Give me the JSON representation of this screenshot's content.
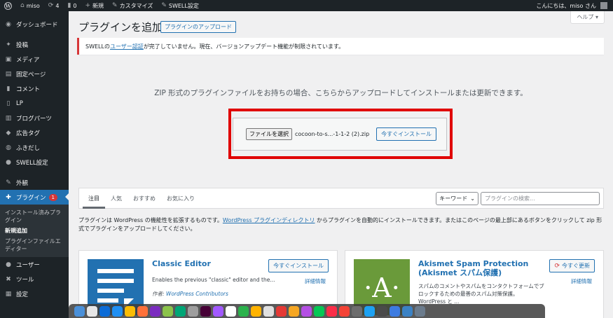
{
  "adminbar": {
    "site_name": "miso",
    "updates_count": "4",
    "comments_count": "0",
    "new_label": "新規",
    "customize_label": "カスタマイズ",
    "swell_label": "SWELL設定",
    "greeting": "こんにちは、miso さん"
  },
  "sidebar": {
    "items": [
      {
        "label": "ダッシュボード",
        "icon": "dashboard-icon"
      },
      {
        "label": "投稿",
        "icon": "pin-icon"
      },
      {
        "label": "メディア",
        "icon": "media-icon"
      },
      {
        "label": "固定ページ",
        "icon": "page-icon"
      },
      {
        "label": "コメント",
        "icon": "comment-icon"
      },
      {
        "label": "LP",
        "icon": "lp-icon"
      },
      {
        "label": "ブログパーツ",
        "icon": "parts-icon"
      },
      {
        "label": "広告タグ",
        "icon": "tag-icon"
      },
      {
        "label": "ふきだし",
        "icon": "balloon-icon"
      },
      {
        "label": "SWELL設定",
        "icon": "swell-icon"
      },
      {
        "label": "外観",
        "icon": "brush-icon"
      },
      {
        "label": "プラグイン",
        "icon": "plugin-icon",
        "badge": "1"
      },
      {
        "label": "ユーザー",
        "icon": "user-icon"
      },
      {
        "label": "ツール",
        "icon": "wrench-icon"
      },
      {
        "label": "設定",
        "icon": "settings-icon"
      }
    ],
    "submenu": [
      "インストール済みプラグイン",
      "新規追加",
      "プラグインファイルエディター"
    ]
  },
  "main": {
    "help_label": "ヘルプ ▾",
    "title": "プラグインを追加",
    "upload_button": "プラグインのアップロード",
    "notice": {
      "prefix": "SWELLの",
      "link": "ユーザー認証",
      "suffix": "が完了していません。現在、バージョンアップデート機能が制限されています。"
    },
    "upload_description": "ZIP 形式のプラグインファイルをお持ちの場合、こちらからアップロードしてインストールまたは更新できます。",
    "file_button": "ファイルを選択",
    "file_name": "cocoon-to-s...-1-1-2 (2).zip",
    "install_now": "今すぐインストール",
    "tabs": [
      "注目",
      "人気",
      "おすすめ",
      "お気に入り"
    ],
    "search": {
      "type_value": "キーワード",
      "placeholder": "プラグインの検索..."
    },
    "info": {
      "part1": "プラグインは WordPress の機能性を拡張するものです。",
      "link": "WordPress プラグインディレクトリ",
      "part2": " からプラグインを自動的にインストールできます。またはこのページの最上部にあるボタンをクリックして zip 形式でプラグインをアップロードしてください。"
    },
    "cards": [
      {
        "name": "Classic Editor",
        "desc": "Enables the previous \"classic\" editor and the...",
        "author_label": "作者: ",
        "author": "WordPress Contributors",
        "button": "今すぐインストール",
        "more": "詳細情報"
      },
      {
        "name": "Akismet Spam Protection (Akismet スパム保護)",
        "desc": "スパムのコメントやスパムをコンタクトフォームでブロックするための最善のスパム対策保護。WordPress と ...",
        "button": "今すぐ更新",
        "more": "詳細情報",
        "logo_letter": "·A·"
      }
    ]
  },
  "colors": {
    "accent": "#2271b1",
    "admin_dark": "#1d2327",
    "highlight_red": "#e00000",
    "akismet_green": "#6a9a3a"
  }
}
